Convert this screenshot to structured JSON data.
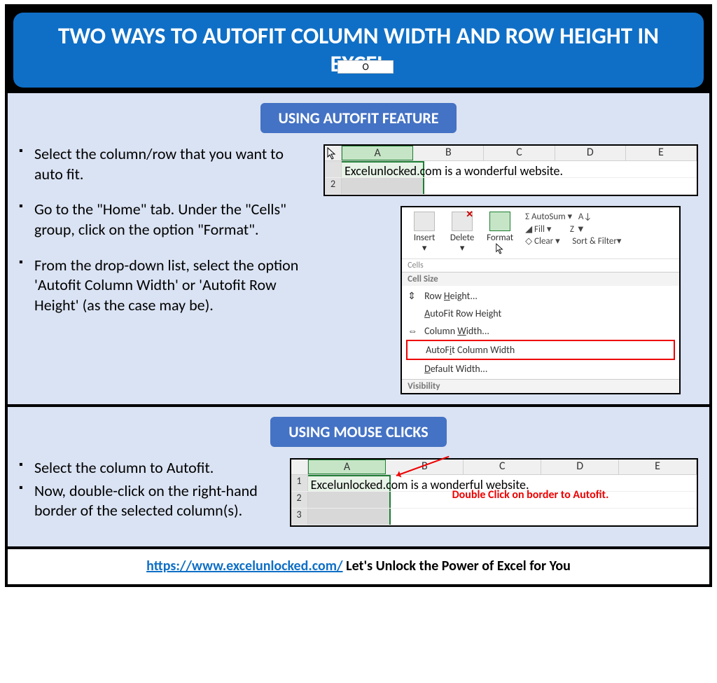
{
  "title": "TWO WAYS TO AUTOFIT COLUMN WIDTH AND ROW HEIGHT IN EXCEL",
  "section1": {
    "heading": "USING AUTOFIT FEATURE",
    "bullets": [
      "Select the column/row that you want to auto fit.",
      "Go to the \"Home\" tab. Under the \"Cells\" group, click on the option \"Format\".",
      "From the drop-down list, select the option 'Autofit Column Width' or 'Autofit Row Height' (as the case may be)."
    ],
    "excel_columns": [
      "A",
      "B",
      "C",
      "D",
      "E"
    ],
    "cell_text": "Excelunlocked.com is a wonderful website.",
    "row_numbers": [
      "2"
    ],
    "ribbon": {
      "buttons": [
        "Insert",
        "Delete",
        "Format"
      ],
      "side": {
        "autosum": "AutoSum",
        "fill": "Fill",
        "clear": "Clear",
        "sort": "Sort & Filter"
      },
      "group_label": "Cells",
      "menu_header": "Cell Size",
      "menu_items": {
        "row_height": "Row Height...",
        "autofit_row": "AutoFit Row Height",
        "col_width": "Column Width...",
        "autofit_col": "AutoFit Column Width",
        "default_width": "Default Width..."
      },
      "visibility": "Visibility"
    },
    "letter_o": "O"
  },
  "section2": {
    "heading": "USING MOUSE CLICKS",
    "bullets": [
      "Select the column to Autofit.",
      "Now, double-click on the right-hand border of the selected column(s)."
    ],
    "excel_columns": [
      "A",
      "B",
      "C",
      "D",
      "E"
    ],
    "cell_text": "Excelunlocked.com is a wonderful website.",
    "row_numbers": [
      "1",
      "2",
      "3"
    ],
    "annotation": "Double Click on border to Autofit."
  },
  "footer": {
    "url_text": "https://www.excelunlocked.com/",
    "tagline": " Let's Unlock the Power of Excel for You"
  }
}
